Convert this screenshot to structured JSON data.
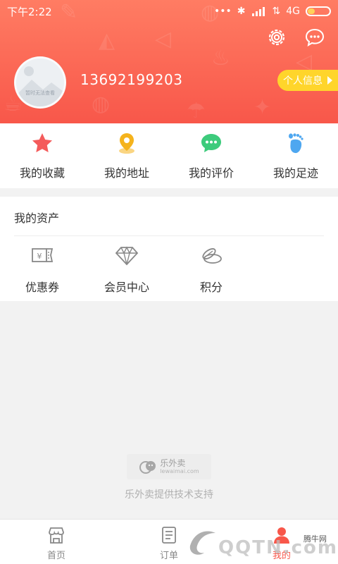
{
  "status": {
    "time": "下午2:22",
    "network": "4G"
  },
  "profile": {
    "phone": "13692199203",
    "avatar_caption": "暂时无法查看",
    "info_button": "个人信息"
  },
  "quick_actions": [
    {
      "label": "我的收藏",
      "icon": "star-icon",
      "color": "#f45b5b"
    },
    {
      "label": "我的地址",
      "icon": "location-pin-icon",
      "color": "#f5b31c"
    },
    {
      "label": "我的评价",
      "icon": "chat-bubble-icon",
      "color": "#3dcb7c"
    },
    {
      "label": "我的足迹",
      "icon": "footprint-icon",
      "color": "#4ea7f0"
    }
  ],
  "assets": {
    "title": "我的资产",
    "items": [
      {
        "label": "优惠券",
        "icon": "coupon-icon"
      },
      {
        "label": "会员中心",
        "icon": "diamond-icon"
      },
      {
        "label": "积分",
        "icon": "coins-icon"
      }
    ]
  },
  "footer": {
    "brand_name": "乐外卖",
    "brand_url": "lewaimai.com",
    "support_text": "乐外卖提供技术支持"
  },
  "bottom_nav": [
    {
      "label": "首页",
      "icon": "home-icon"
    },
    {
      "label": "订单",
      "icon": "order-list-icon"
    },
    {
      "label": "我的",
      "icon": "user-icon"
    }
  ],
  "watermark": {
    "site": "腾牛网",
    "text": "QQTN.com"
  }
}
